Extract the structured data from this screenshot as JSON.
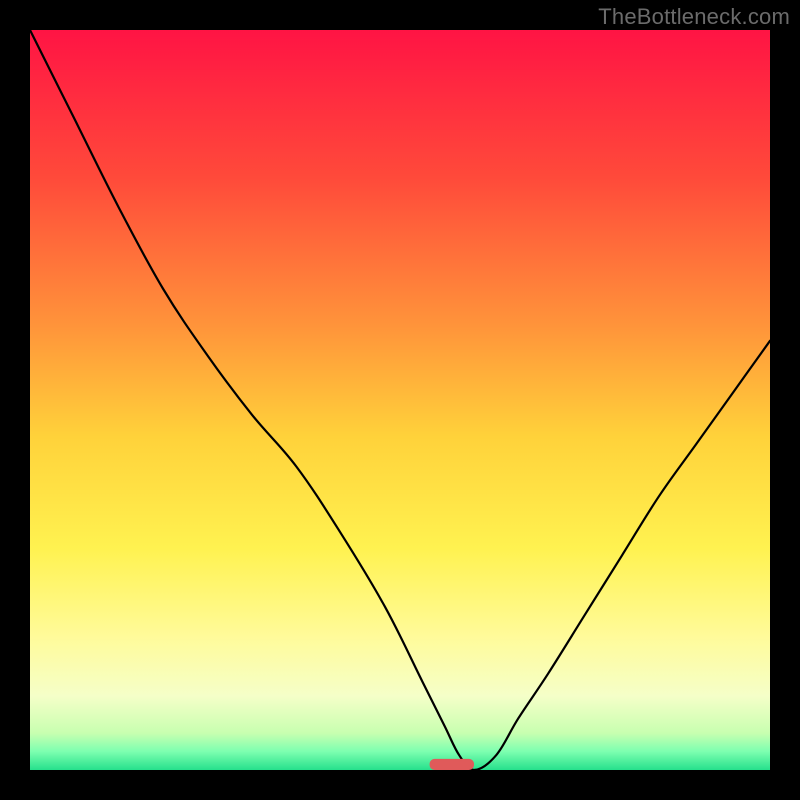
{
  "watermark": "TheBottleneck.com",
  "colors": {
    "border": "#000000",
    "curve": "#000000",
    "marker": "#e05a5a",
    "gradient_stops": [
      {
        "offset": 0.0,
        "color": "#ff1444"
      },
      {
        "offset": 0.2,
        "color": "#ff4a3a"
      },
      {
        "offset": 0.4,
        "color": "#ff943a"
      },
      {
        "offset": 0.55,
        "color": "#ffd23a"
      },
      {
        "offset": 0.7,
        "color": "#fff250"
      },
      {
        "offset": 0.82,
        "color": "#fffb9a"
      },
      {
        "offset": 0.9,
        "color": "#f5ffc8"
      },
      {
        "offset": 0.95,
        "color": "#c8ffb0"
      },
      {
        "offset": 0.975,
        "color": "#7dffb0"
      },
      {
        "offset": 1.0,
        "color": "#26e08c"
      }
    ]
  },
  "chart_data": {
    "type": "line",
    "title": "",
    "xlabel": "",
    "ylabel": "",
    "xlim": [
      0,
      100
    ],
    "ylim": [
      0,
      100
    ],
    "grid": false,
    "series": [
      {
        "name": "curve",
        "x": [
          0,
          6,
          12,
          18,
          24,
          30,
          36,
          42,
          48,
          53,
          56,
          58,
          60,
          63,
          66,
          70,
          75,
          80,
          85,
          90,
          95,
          100
        ],
        "y": [
          100,
          88,
          76,
          65,
          56,
          48,
          41,
          32,
          22,
          12,
          6,
          2,
          0,
          2,
          7,
          13,
          21,
          29,
          37,
          44,
          51,
          58
        ]
      }
    ],
    "marker": {
      "name": "minimum-pill",
      "x_center": 57,
      "y": 0,
      "width": 6,
      "height": 1.5,
      "color": "#e05a5a"
    }
  }
}
